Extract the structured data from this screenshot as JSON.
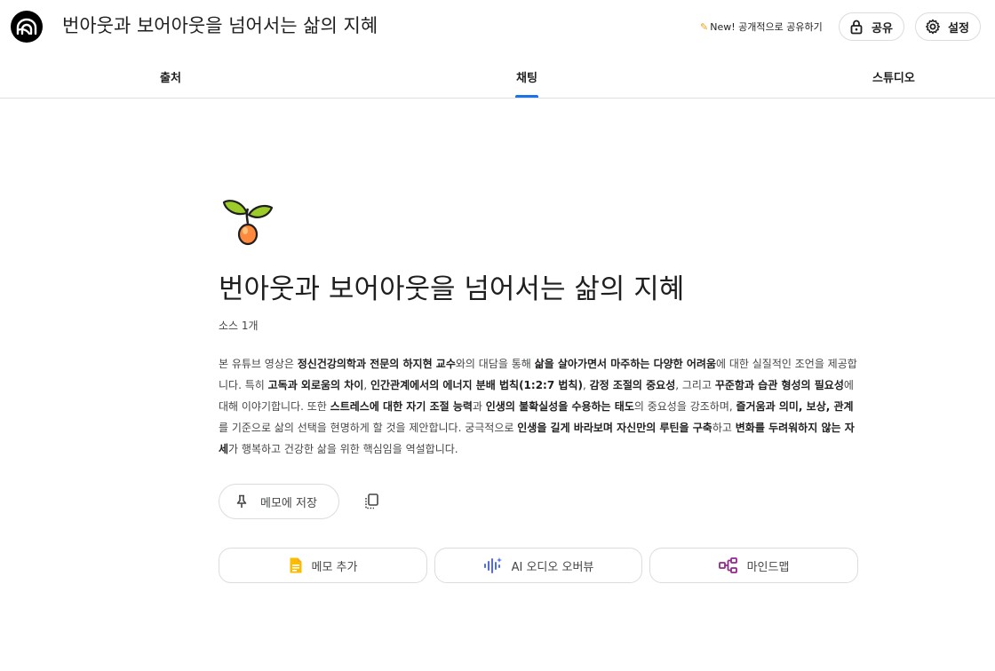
{
  "header": {
    "app_title": "번아웃과 보어아웃을 넘어서는 삶의 지혜",
    "new_share_label": "New! 공개적으로 공유하기",
    "share_label": "공유",
    "settings_label": "설정",
    "logo_icon": "notebooklm-logo-icon"
  },
  "tabs": [
    {
      "label": "출처",
      "active": false
    },
    {
      "label": "채팅",
      "active": true
    },
    {
      "label": "스튜디오",
      "active": false
    }
  ],
  "accent_color": "#1a73e8",
  "notebook": {
    "emoji_icon": "seedling-icon",
    "title": "번아웃과 보어아웃을 넘어서는 삶의 지혜",
    "source_count": "소스 1개",
    "summary_segments": [
      {
        "text": "본 유튜브 영상은 ",
        "bold": false
      },
      {
        "text": "정신건강의학과 전문의 하지현 교수",
        "bold": true
      },
      {
        "text": "와의 대담을 통해 ",
        "bold": false
      },
      {
        "text": "삶을 살아가면서 마주하는 다양한 어려움",
        "bold": true
      },
      {
        "text": "에 대한 실질적인 조언을 제공합니다. 특히 ",
        "bold": false
      },
      {
        "text": "고독과 외로움의 차이",
        "bold": true
      },
      {
        "text": ", ",
        "bold": false
      },
      {
        "text": "인간관계에서의 에너지 분배 법칙(1:2:7 법칙)",
        "bold": true
      },
      {
        "text": ", ",
        "bold": false
      },
      {
        "text": "감정 조절의 중요성",
        "bold": true
      },
      {
        "text": ", 그리고 ",
        "bold": false
      },
      {
        "text": "꾸준함과 습관 형성의 필요성",
        "bold": true
      },
      {
        "text": "에 대해 이야기합니다. 또한 ",
        "bold": false
      },
      {
        "text": "스트레스에 대한 자기 조절 능력",
        "bold": true
      },
      {
        "text": "과 ",
        "bold": false
      },
      {
        "text": "인생의 불확실성을 수용하는 태도",
        "bold": true
      },
      {
        "text": "의 중요성을 강조하며, ",
        "bold": false
      },
      {
        "text": "즐거움과 의미, 보상, 관계",
        "bold": true
      },
      {
        "text": "를 기준으로 삶의 선택을 현명하게 할 것을 제안합니다. 궁극적으로 ",
        "bold": false
      },
      {
        "text": "인생을 길게 바라보며 자신만의 루틴을 구축",
        "bold": true
      },
      {
        "text": "하고 ",
        "bold": false
      },
      {
        "text": "변화를 두려워하지 않는 자세",
        "bold": true
      },
      {
        "text": "가 행복하고 건강한 삶을 위한 핵심임을 역설합니다.",
        "bold": false
      }
    ]
  },
  "actions": {
    "save_memo_label": "메모에 저장",
    "add_memo_label": "메모 추가",
    "audio_overview_label": "AI 오디오 오버뷰",
    "mindmap_label": "마인드맵"
  }
}
